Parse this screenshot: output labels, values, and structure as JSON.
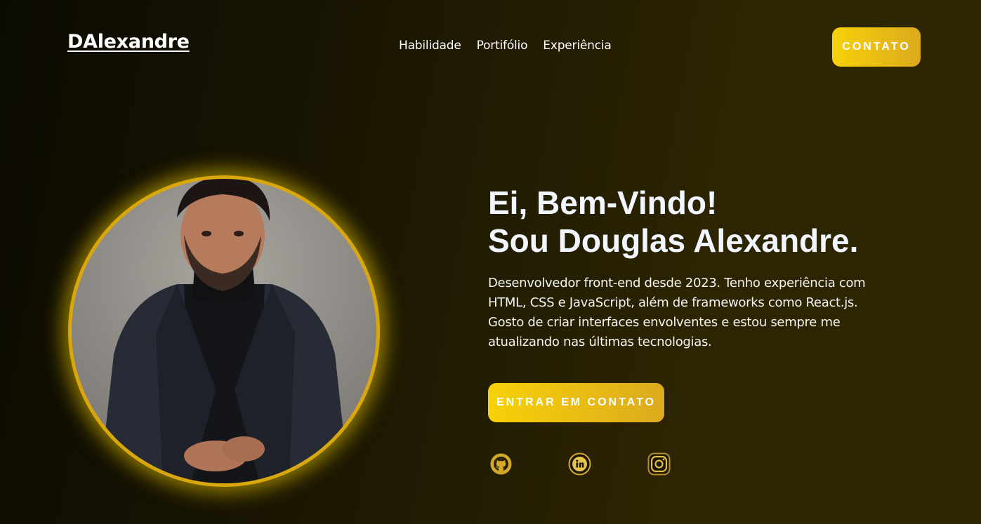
{
  "header": {
    "logo": "DAlexandre",
    "nav": [
      "Habilidade",
      "Portifólio",
      "Experiência"
    ],
    "contact_button": "CONTATO"
  },
  "hero": {
    "title_line1": "Ei, Bem-Vindo!",
    "title_line2": "Sou Douglas Alexandre.",
    "description_line1": "Desenvolvedor front-end desde 2023. Tenho experiência com HTML, CSS e JavaScript, além de frameworks como React.js.",
    "description_line2": "Gosto de criar interfaces envolventes e estou sempre me atualizando nas últimas tecnologias.",
    "cta_button": "ENTRAR EM CONTATO",
    "socials": [
      "github-icon",
      "linkedin-icon",
      "instagram-icon"
    ]
  },
  "colors": {
    "accent_start": "#f7d108",
    "accent_end": "#dcaa1e",
    "background_dark": "#0c0b02",
    "background_warm": "#2f2603"
  }
}
